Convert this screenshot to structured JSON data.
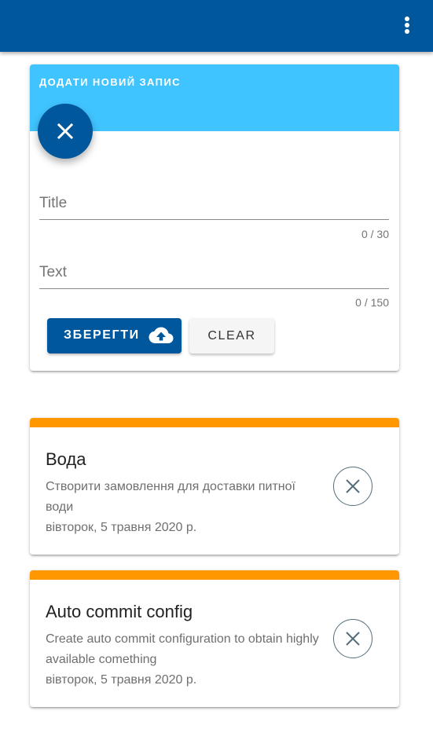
{
  "appbar": {
    "menu_icon": "more-vert-icon",
    "color": "#01579b"
  },
  "form": {
    "title": "ДОДАТИ НОВИЙ ЗАПИС",
    "header_color": "#40c4ff",
    "close_icon": "close-icon",
    "title_field": {
      "placeholder": "Title",
      "counter": "0 / 30"
    },
    "text_field": {
      "placeholder": "Text",
      "counter": "0 / 150"
    },
    "save_label": "ЗБЕРЕГТИ",
    "save_icon": "cloud-upload-icon",
    "clear_label": "CLEAR"
  },
  "notes": [
    {
      "title": "Вода",
      "text": "Створити замовлення для доставки питної води",
      "date": "вівторок, 5 травня 2020 р.",
      "stripe_color": "#ff9800",
      "delete_icon": "close-icon"
    },
    {
      "title": "Auto commit config",
      "text": "Create auto commit configuration to obtain highly available comething",
      "date": "вівторок, 5 травня 2020 р.",
      "stripe_color": "#ff9800",
      "delete_icon": "close-icon"
    }
  ]
}
